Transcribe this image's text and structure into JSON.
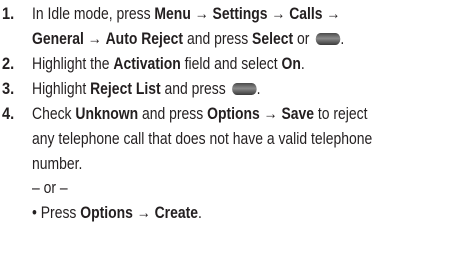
{
  "steps": [
    {
      "number": "1.",
      "line1": {
        "t1": "In Idle mode, press ",
        "b1": "Menu",
        "t2": " → ",
        "b2": "Settings",
        "t3": " → ",
        "b3": "Calls",
        "t4": " →"
      },
      "line2": {
        "b1": "General",
        "t1": " → ",
        "b2": "Auto Reject",
        "t2": " and press ",
        "b3": "Select",
        "t3": " or ",
        "t4": "."
      }
    },
    {
      "number": "2.",
      "t1": "Highlight the ",
      "b1": "Activation",
      "t2": " field and select ",
      "b2": "On",
      "t3": "."
    },
    {
      "number": "3.",
      "t1": "Highlight ",
      "b1": "Reject List",
      "t2": " and press ",
      "t3": "."
    },
    {
      "number": "4.",
      "line1": {
        "t1": "Check ",
        "b1": "Unknown",
        "t2": " and press ",
        "b2": "Options",
        "t3": " → ",
        "b3": "Save",
        "t4": " to reject"
      },
      "line2": "any telephone call that does not have a valid telephone",
      "line3": "number.",
      "or_text": "– or –",
      "bullet": {
        "mark": "•",
        "t1": " Press ",
        "b1": "Options",
        "t2": " → ",
        "b2": "Create",
        "t3": "."
      }
    }
  ],
  "icons": {
    "softkey": "menu-softkey-button-icon"
  }
}
